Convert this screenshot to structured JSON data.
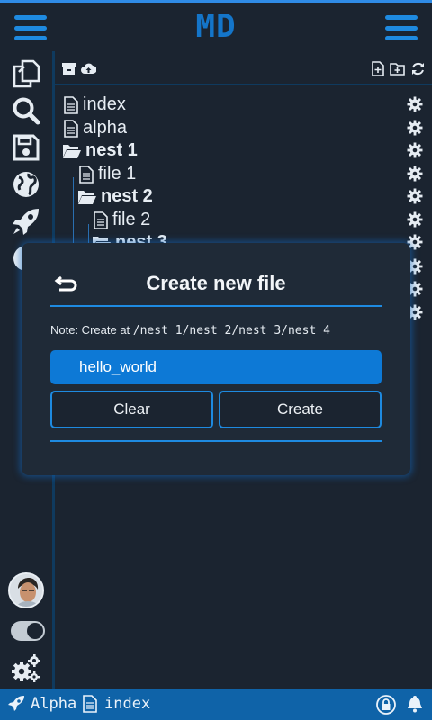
{
  "header": {
    "logo": "MD"
  },
  "sidebar": {
    "icons": [
      "files-icon",
      "search-icon",
      "save-icon",
      "globe-icon",
      "rocket-icon",
      "info-icon"
    ],
    "theme_toggle_on": true
  },
  "toolbar": {
    "left_icons": [
      "archive-icon",
      "cloud-upload-icon"
    ],
    "right_icons": [
      "new-file-icon",
      "new-folder-icon",
      "refresh-icon"
    ]
  },
  "tree": {
    "items": [
      {
        "label": "index",
        "type": "file",
        "depth": 0
      },
      {
        "label": "alpha",
        "type": "file",
        "depth": 0
      },
      {
        "label": "nest 1",
        "type": "folder",
        "depth": 0
      },
      {
        "label": "file 1",
        "type": "file",
        "depth": 1
      },
      {
        "label": "nest 2",
        "type": "folder",
        "depth": 1
      },
      {
        "label": "file 2",
        "type": "file",
        "depth": 2
      },
      {
        "label": "nest 3",
        "type": "folder",
        "depth": 2
      }
    ]
  },
  "modal": {
    "title": "Create new file",
    "note_prefix": "Note: Create at",
    "note_path": "/nest 1/nest 2/nest 3/nest 4",
    "input_value": "hello_world",
    "clear_label": "Clear",
    "create_label": "Create"
  },
  "status": {
    "project": "Alpha",
    "file": "index"
  },
  "colors": {
    "accent": "#1e8ae0",
    "background": "#1b2430",
    "statusbar": "#0f63a8",
    "input": "#0d79d6"
  }
}
